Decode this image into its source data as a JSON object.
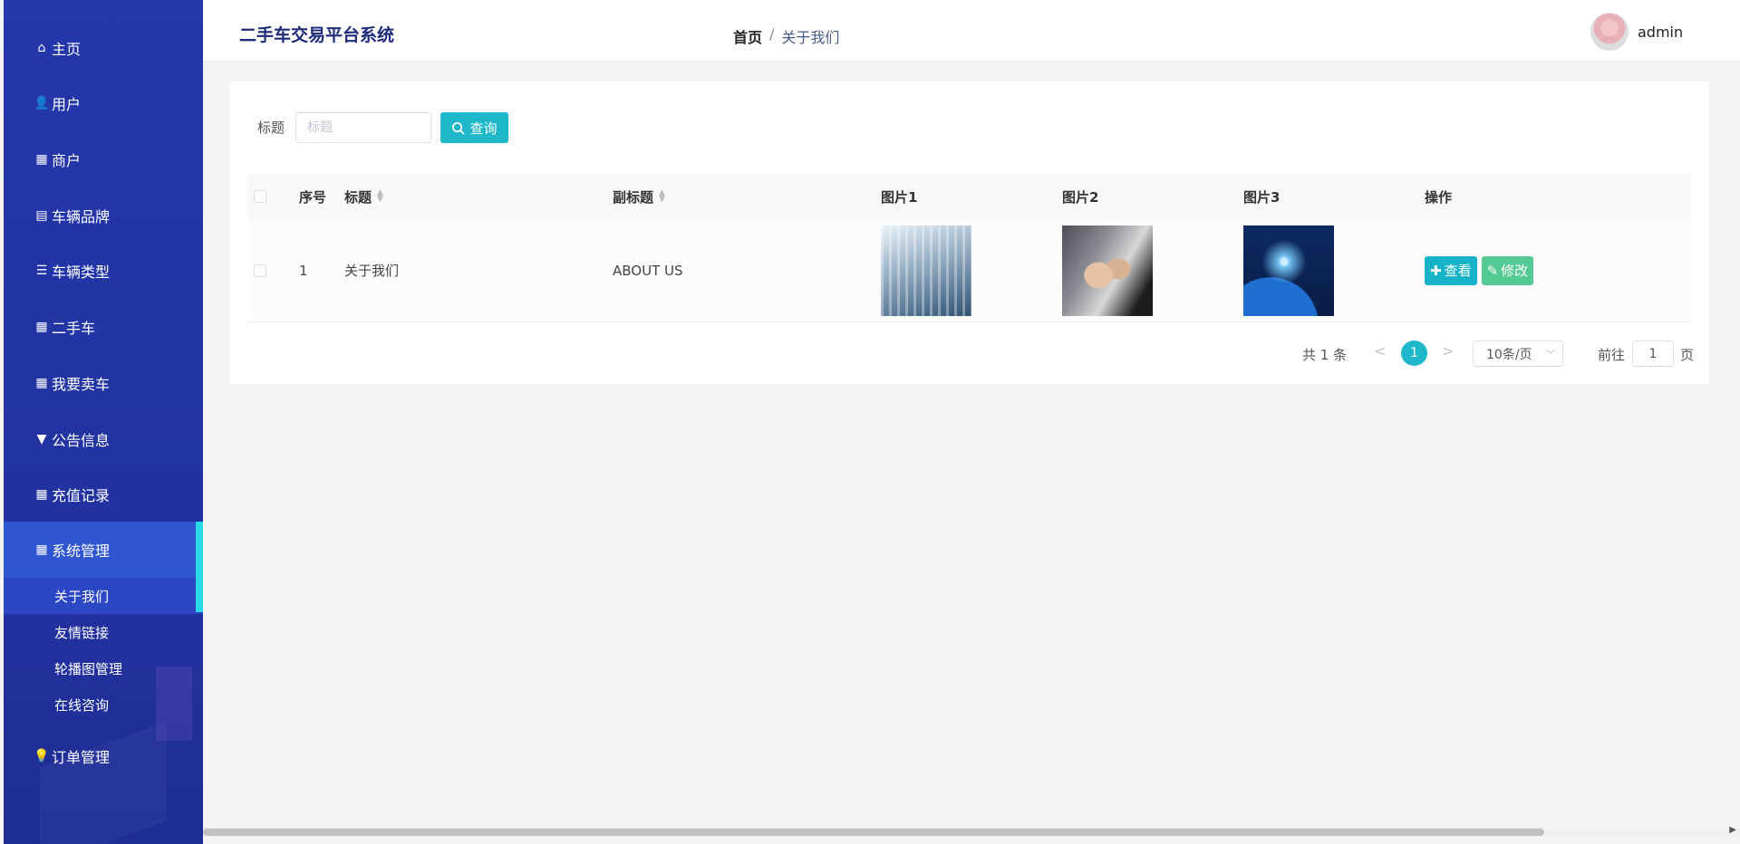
{
  "sidebar": {
    "items": [
      {
        "label": "主页",
        "icon": "home-icon",
        "glyph": "⌂"
      },
      {
        "label": "用户",
        "icon": "user-icon",
        "glyph": "👤"
      },
      {
        "label": "商户",
        "icon": "grid-icon",
        "glyph": "▦"
      },
      {
        "label": "车辆品牌",
        "icon": "clipboard-icon",
        "glyph": "▤"
      },
      {
        "label": "车辆类型",
        "icon": "list-icon",
        "glyph": "☰"
      },
      {
        "label": "二手车",
        "icon": "grid-icon",
        "glyph": "▦"
      },
      {
        "label": "我要卖车",
        "icon": "grid-icon",
        "glyph": "▦"
      },
      {
        "label": "公告信息",
        "icon": "bookmark-icon",
        "glyph": "▼"
      },
      {
        "label": "充值记录",
        "icon": "grid-icon",
        "glyph": "▦"
      },
      {
        "label": "系统管理",
        "icon": "grid-icon",
        "glyph": "▦"
      },
      {
        "label": "订单管理",
        "icon": "bulb-icon",
        "glyph": "💡"
      }
    ],
    "submenu": [
      "关于我们",
      "友情链接",
      "轮播图管理",
      "在线咨询"
    ]
  },
  "header": {
    "title": "二手车交易平台系统",
    "breadcrumb_home": "首页",
    "breadcrumb_sep": "/",
    "breadcrumb_current": "关于我们",
    "username": "admin"
  },
  "search": {
    "label": "标题",
    "placeholder": "标题",
    "button": "查询"
  },
  "table": {
    "columns": [
      "序号",
      "标题",
      "副标题",
      "图片1",
      "图片2",
      "图片3",
      "操作"
    ],
    "rows": [
      {
        "index": "1",
        "title": "关于我们",
        "subtitle": "ABOUT US"
      }
    ],
    "actions": {
      "view": "查看",
      "edit": "修改"
    }
  },
  "pagination": {
    "total": "共 1 条",
    "prev": "<",
    "current": "1",
    "next": ">",
    "page_size": "10条/页",
    "goto_label": "前往",
    "goto_value": "1",
    "goto_suffix": "页"
  },
  "colors": {
    "sidebar": "#2335a7",
    "accent": "#1fb8ca",
    "edit": "#53c993",
    "active_bar": "#28d7e8"
  }
}
